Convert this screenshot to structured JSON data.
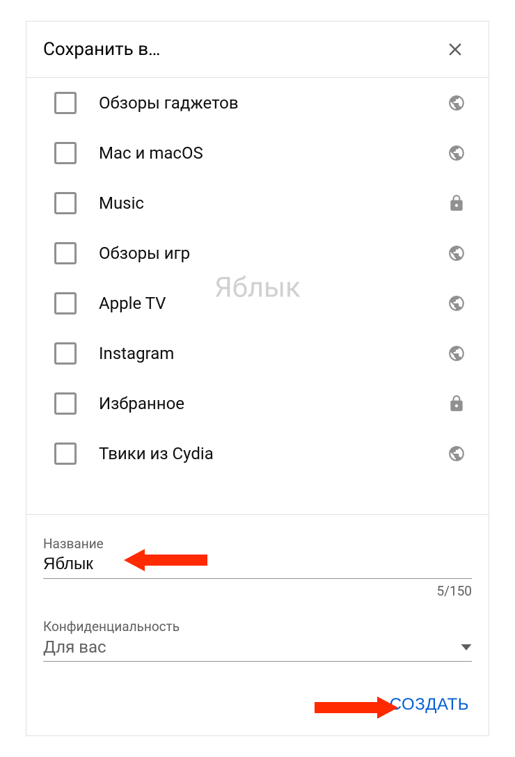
{
  "dialog": {
    "title": "Сохранить в…"
  },
  "watermark": "Яблык",
  "playlists": [
    {
      "label": "Обзоры гаджетов",
      "privacy": "public"
    },
    {
      "label": "Mac и macOS",
      "privacy": "public"
    },
    {
      "label": "Music",
      "privacy": "private"
    },
    {
      "label": "Обзоры игр",
      "privacy": "public"
    },
    {
      "label": "Apple TV",
      "privacy": "public"
    },
    {
      "label": "Instagram",
      "privacy": "public"
    },
    {
      "label": "Избранное",
      "privacy": "private"
    },
    {
      "label": "Твики из Cydia",
      "privacy": "public"
    }
  ],
  "form": {
    "name_label": "Название",
    "name_value": "Яблык",
    "char_counter": "5/150",
    "privacy_label": "Конфиденциальность",
    "privacy_value": "Для вас",
    "create_button": "СОЗДАТЬ"
  }
}
